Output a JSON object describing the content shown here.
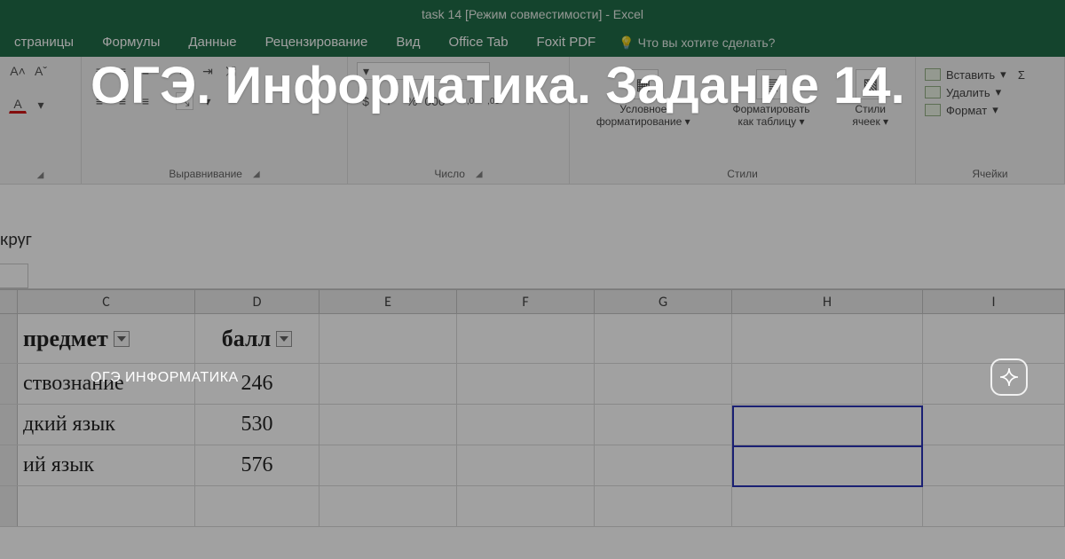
{
  "titlebar": {
    "text": "task 14  [Режим совместимости] - Excel"
  },
  "tabs": {
    "page": "страницы",
    "formulas": "Формулы",
    "data": "Данные",
    "review": "Рецензирование",
    "view": "Вид",
    "office_tab": "Office Tab",
    "foxit": "Foxit PDF",
    "tellme": "Что вы хотите сделать?"
  },
  "ribbon": {
    "alignment": "Выравнивание",
    "number": "Число",
    "styles": "Стили",
    "cells": "Ячейки",
    "cond_format_l1": "Условное",
    "cond_format_l2": "форматирование",
    "format_table_l1": "Форматировать",
    "format_table_l2": "как таблицу",
    "cell_styles_l1": "Стили",
    "cell_styles_l2": "ячеек",
    "insert": "Вставить",
    "delete": "Удалить",
    "format": "Формат",
    "percent": "%",
    "thousands": "000",
    "inc_dec_a": ",0",
    "inc_dec_b": ",00"
  },
  "formula_bar": {
    "text": "круг"
  },
  "columns": {
    "C": "C",
    "D": "D",
    "E": "E",
    "F": "F",
    "G": "G",
    "H": "H",
    "I": "I"
  },
  "table": {
    "header": {
      "subject": "предмет",
      "score": "балл"
    },
    "rows": [
      {
        "subject": "ствознание",
        "score": "246"
      },
      {
        "subject": "дкий язык",
        "score": "530"
      },
      {
        "subject": "ий язык",
        "score": "576"
      }
    ]
  },
  "overlay": {
    "headline": "ОГЭ. Информатика. Задание 14.",
    "channel": "ОГЭ ИНФОРМАТИКА"
  }
}
